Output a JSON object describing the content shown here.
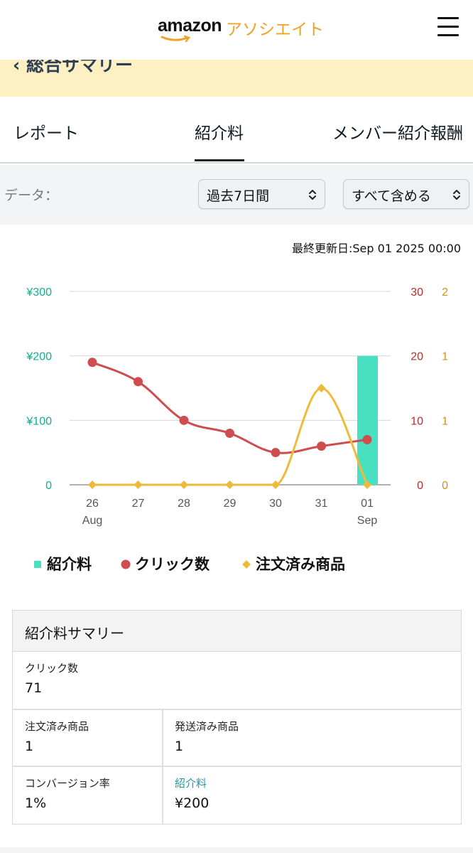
{
  "header": {
    "logo_text": "amazon",
    "logo_suffix": "アソシエイト",
    "menu_icon": "hamburger-menu-icon"
  },
  "banner": {
    "back_link": "‹ 総合サマリー"
  },
  "tabs": [
    {
      "label": "レポート",
      "active": false
    },
    {
      "label": "紹介料",
      "active": true
    },
    {
      "label": "メンバー紹介報酬",
      "active": false
    }
  ],
  "filters": {
    "label": "データ：",
    "period": "過去7日間",
    "scope": "すべて含める"
  },
  "last_updated": "最終更新日:Sep 01 2025 00:00",
  "colors": {
    "fee": "#48e0c0",
    "clicks": "#cf4d4f",
    "orders": "#eeba3a",
    "axis_fee": "#0eae8d",
    "axis_clicks": "#b22f2f",
    "axis_orders": "#c99618"
  },
  "chart_data": {
    "type": "bar+line",
    "categories": [
      "26",
      "27",
      "28",
      "29",
      "30",
      "31",
      "01"
    ],
    "category_sublabels": [
      "Aug",
      "",
      "",
      "",
      "",
      "",
      "Sep"
    ],
    "series": [
      {
        "name": "紹介料",
        "type": "bar",
        "axis": "left",
        "values": [
          0,
          0,
          0,
          0,
          0,
          0,
          200
        ]
      },
      {
        "name": "クリック数",
        "type": "line",
        "axis": "right1",
        "values": [
          19,
          16,
          10,
          8,
          5,
          6,
          7
        ]
      },
      {
        "name": "注文済み商品",
        "type": "line",
        "axis": "right2",
        "values": [
          0,
          0,
          0,
          0,
          0,
          1,
          0
        ]
      }
    ],
    "y_left": {
      "ticks": [
        "¥300",
        "¥200",
        "¥100",
        "0"
      ],
      "ylim": [
        0,
        300
      ]
    },
    "y_right1": {
      "ticks": [
        "30",
        "20",
        "10",
        "0"
      ],
      "ylim": [
        0,
        30
      ]
    },
    "y_right2": {
      "ticks": [
        "2",
        "1",
        "1",
        "0"
      ],
      "ylim": [
        0,
        2
      ]
    },
    "grid": true,
    "legend": "bottom"
  },
  "legend": [
    {
      "label": "紹介料",
      "marker": "square"
    },
    {
      "label": "クリック数",
      "marker": "circle"
    },
    {
      "label": "注文済み商品",
      "marker": "diamond"
    }
  ],
  "summary": {
    "title": "紹介料サマリー",
    "clicks_label": "クリック数",
    "clicks_value": "71",
    "ordered_label": "注文済み商品",
    "ordered_value": "1",
    "shipped_label": "発送済み商品",
    "shipped_value": "1",
    "conversion_label": "コンバージョン率",
    "conversion_value": "1%",
    "fee_label": "紹介料",
    "fee_value": "¥200"
  }
}
